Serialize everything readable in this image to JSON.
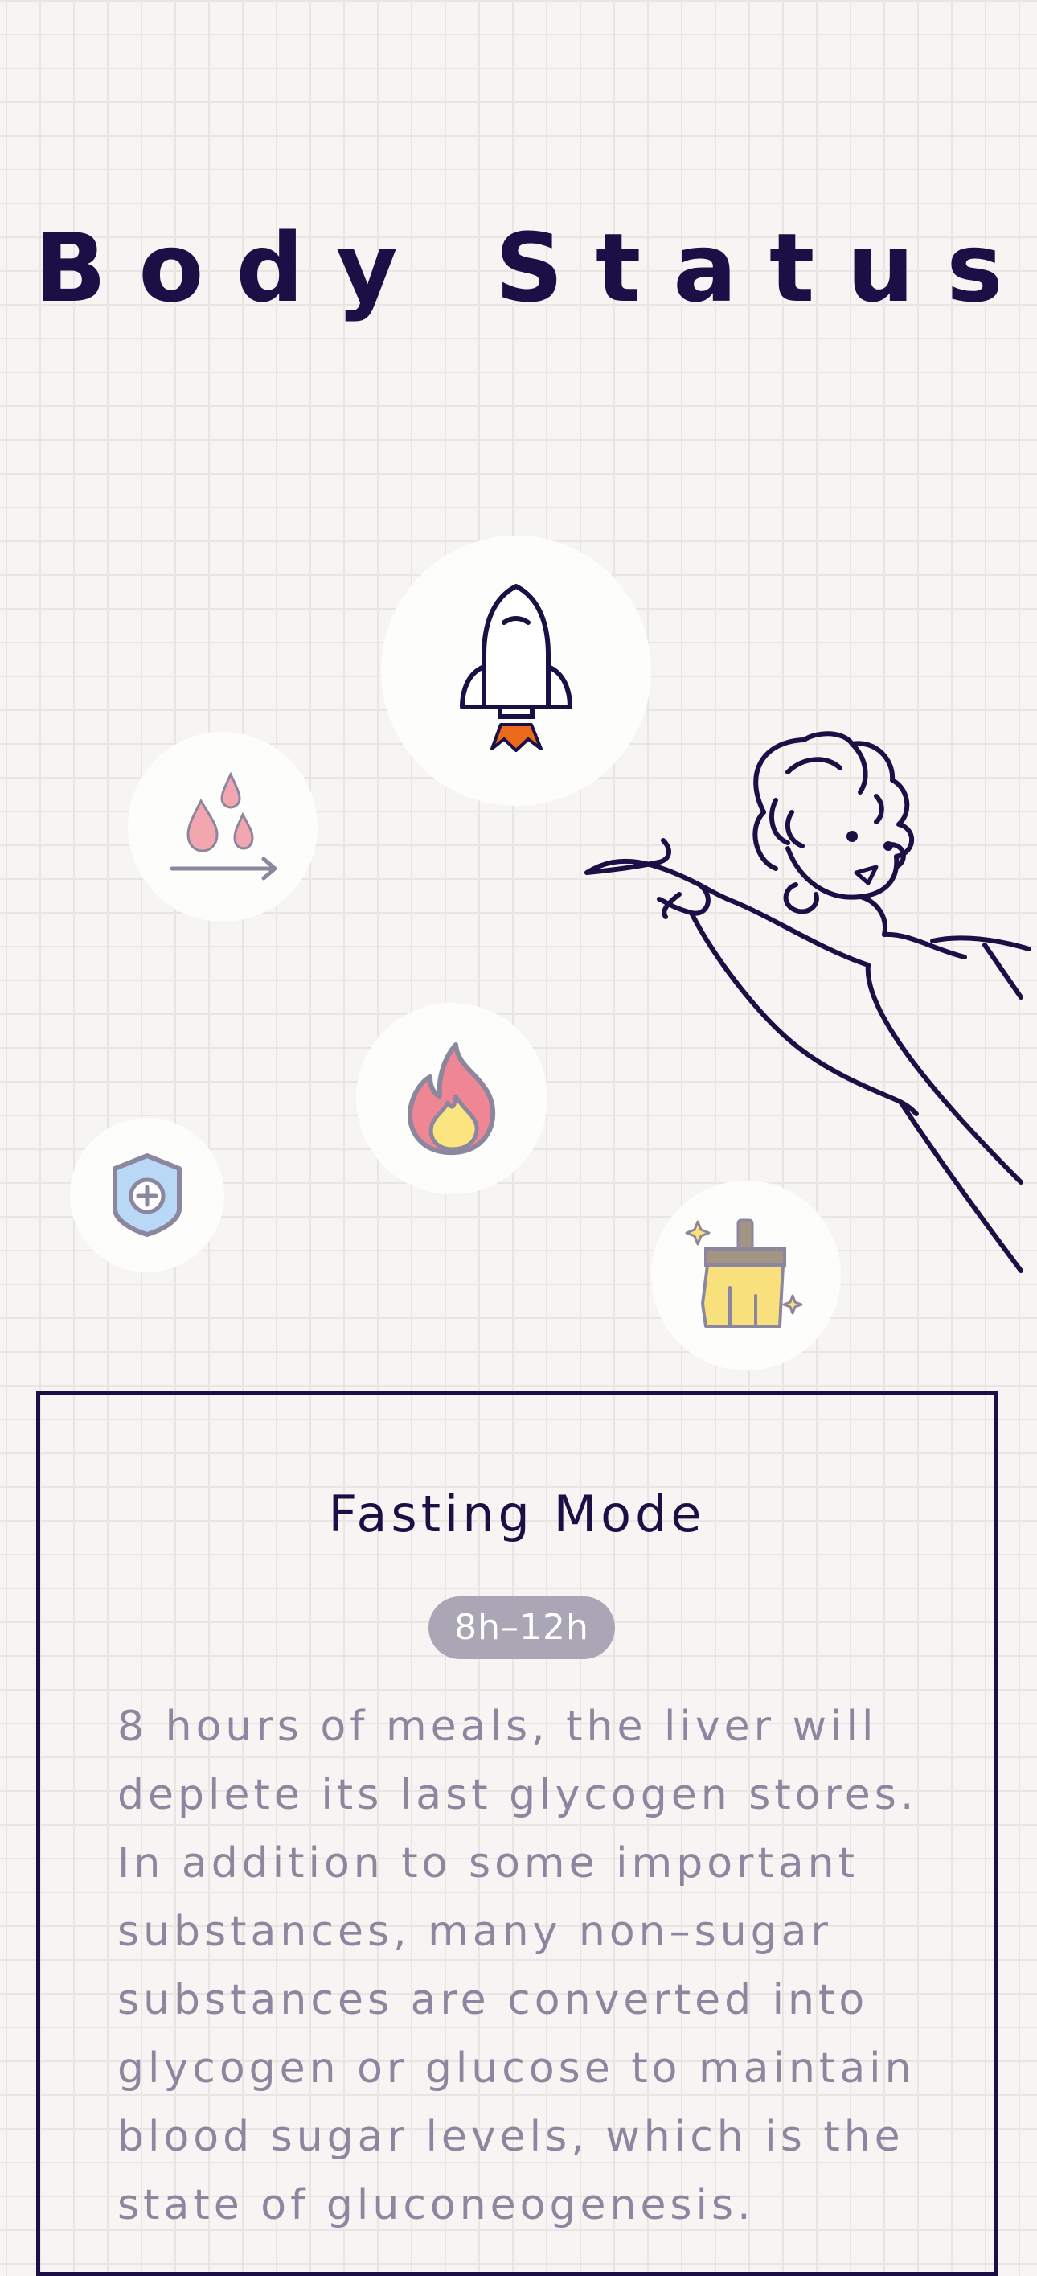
{
  "page": {
    "title": "Body Status"
  },
  "icons": {
    "rocket": "rocket-icon",
    "drops": "water-drops-icon",
    "flame": "flame-icon",
    "shield": "shield-plus-icon",
    "brush": "cleaning-brush-icon"
  },
  "colors": {
    "navy": "#1a1046",
    "muted_text": "#8d869f",
    "badge_bg": "#aaa6b6",
    "flame_red": "#ee8793",
    "flame_yellow": "#fae580",
    "rocket_flame": "#ec6a1c",
    "shield_blue": "#b9d8f5",
    "brush_yellow": "#f8e07d",
    "brush_handle": "#a39584"
  },
  "card": {
    "title": "Fasting Mode",
    "badge": "8h–12h",
    "lines": [
      "8 hours of meals, the liver will",
      "deplete its last glycogen stores.",
      "In addition to some important",
      "substances, many non–sugar",
      "substances are converted into",
      "glycogen or glucose to maintain",
      "blood sugar levels, which is the",
      "state of gluconeogenesis."
    ]
  }
}
